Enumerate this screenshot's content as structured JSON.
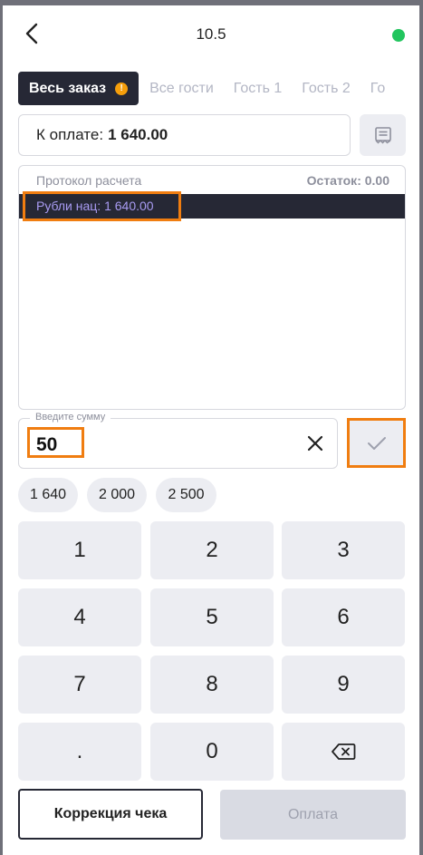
{
  "header": {
    "title": "10.5",
    "status_color": "#22c55e"
  },
  "tabs": [
    {
      "label": "Весь заказ",
      "active": true,
      "badge": "!"
    },
    {
      "label": "Все гости"
    },
    {
      "label": "Гость 1"
    },
    {
      "label": "Гость 2"
    },
    {
      "label": "Го"
    }
  ],
  "payment": {
    "label": "К оплате:",
    "amount": "1 640.00"
  },
  "protocol": {
    "title": "Протокол расчета",
    "remainder": "Остаток: 0.00",
    "rows": [
      {
        "text": "Рубли нац: 1 640.00"
      }
    ]
  },
  "amount_input": {
    "label": "Введите сумму",
    "value": "50"
  },
  "quick_amounts": [
    "1 640",
    "2 000",
    "2 500"
  ],
  "keypad": [
    "1",
    "2",
    "3",
    "4",
    "5",
    "6",
    "7",
    "8",
    "9",
    ".",
    "0",
    "backspace"
  ],
  "footer": {
    "correction_label": "Коррекция чека",
    "pay_label": "Оплата"
  },
  "colors": {
    "accent_highlight": "#f07d10",
    "dark": "#262835",
    "protocol_text": "#a89bf2"
  }
}
